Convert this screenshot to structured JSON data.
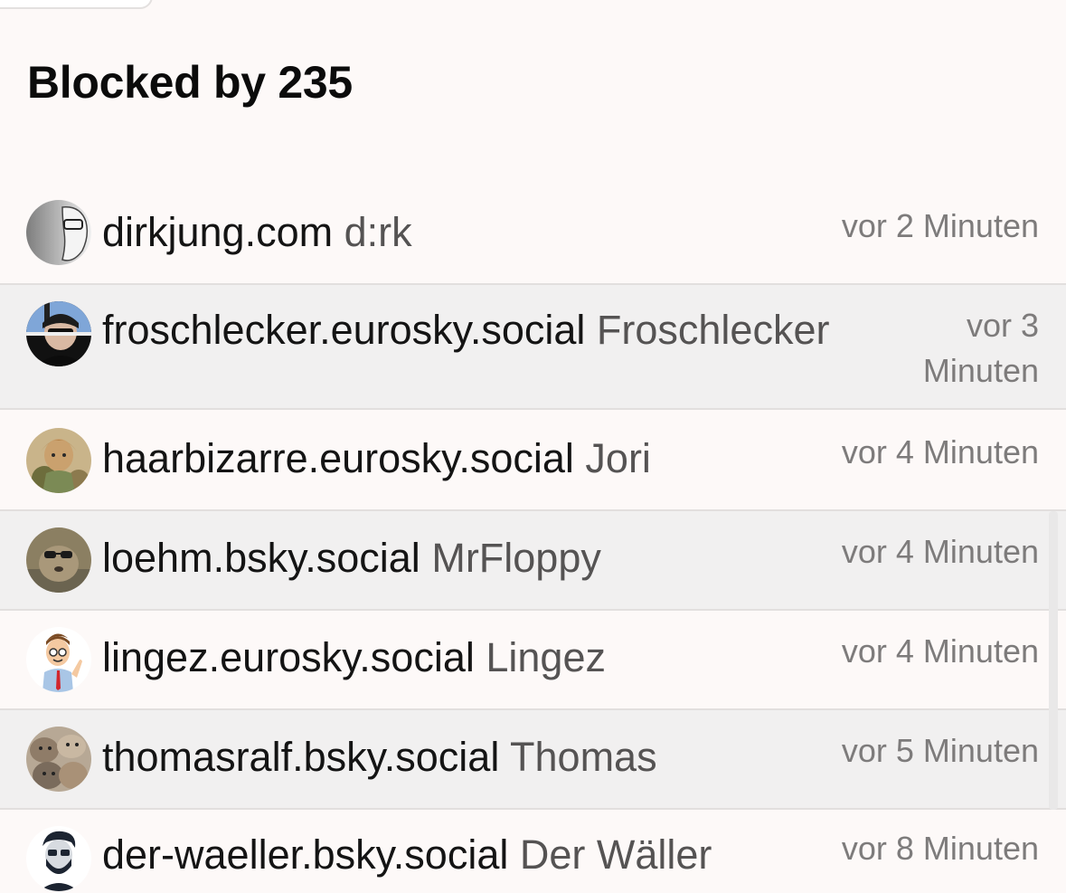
{
  "page": {
    "title": "Blocked by 235"
  },
  "blocked_users": [
    {
      "handle": "dirkjung.com",
      "display_name": "d:rk",
      "time": "vor 2 Minuten",
      "avatar": "grayscale-profile-photo"
    },
    {
      "handle": "froschlecker.eurosky.social",
      "display_name": "Froschlecker",
      "time": "vor 3 Minuten",
      "avatar": "person-with-sunglasses-photo"
    },
    {
      "handle": "haarbizarre.eurosky.social",
      "display_name": "Jori",
      "time": "vor 4 Minuten",
      "avatar": "doll-figure-photo"
    },
    {
      "handle": "loehm.bsky.social",
      "display_name": "MrFloppy",
      "time": "vor 4 Minuten",
      "avatar": "animal-with-sunglasses-photo"
    },
    {
      "handle": "lingez.eurosky.social",
      "display_name": "Lingez",
      "time": "vor 4 Minuten",
      "avatar": "cartoon-man-waving"
    },
    {
      "handle": "thomasralf.bsky.social",
      "display_name": "Thomas",
      "time": "vor 5 Minuten",
      "avatar": "kittens-photo"
    },
    {
      "handle": "der-waeller.bsky.social",
      "display_name": "Der Wäller",
      "time": "vor 8 Minuten",
      "avatar": "bearded-man-illustration"
    }
  ]
}
